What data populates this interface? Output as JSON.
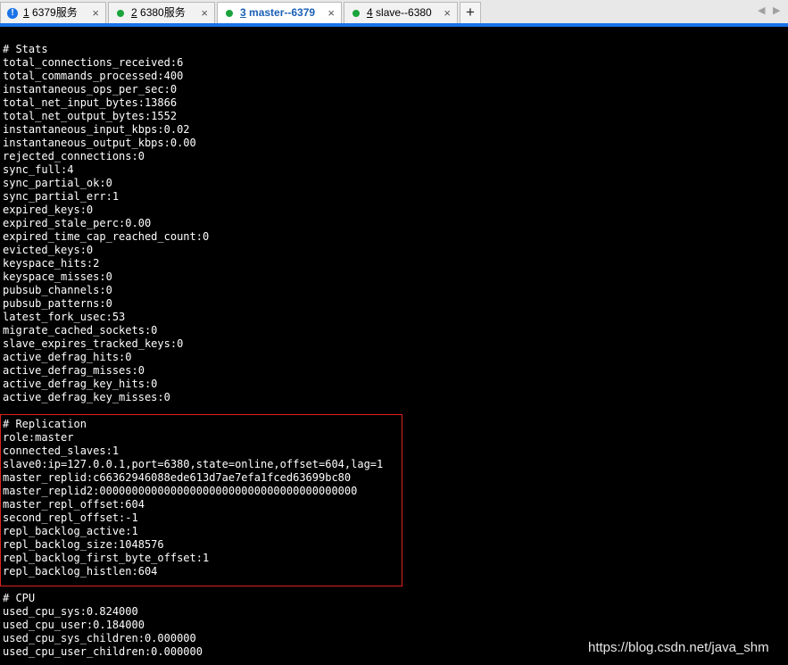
{
  "tabs": [
    {
      "index": "1",
      "title": "6379服务",
      "status_icon": "warning-icon",
      "close": "×"
    },
    {
      "index": "2",
      "title": "6380服务",
      "status_icon": "green-dot-icon",
      "close": "×"
    },
    {
      "index": "3",
      "title": "master--6379",
      "status_icon": "green-dot-icon",
      "close": "×",
      "active": true
    },
    {
      "index": "4",
      "title": "slave--6380",
      "status_icon": "green-dot-icon",
      "close": "×"
    }
  ],
  "new_tab_label": "+",
  "nav": {
    "prev": "◀",
    "next": "▶"
  },
  "colors": {
    "accent": "#1a73e8",
    "status_green": "#1aa33c",
    "highlight_border": "#e02020",
    "terminal_bg": "#000000",
    "terminal_text": "#ffffff"
  },
  "terminal": {
    "stats": [
      "# Stats",
      "total_connections_received:6",
      "total_commands_processed:400",
      "instantaneous_ops_per_sec:0",
      "total_net_input_bytes:13866",
      "total_net_output_bytes:1552",
      "instantaneous_input_kbps:0.02",
      "instantaneous_output_kbps:0.00",
      "rejected_connections:0",
      "sync_full:4",
      "sync_partial_ok:0",
      "sync_partial_err:1",
      "expired_keys:0",
      "expired_stale_perc:0.00",
      "expired_time_cap_reached_count:0",
      "evicted_keys:0",
      "keyspace_hits:2",
      "keyspace_misses:0",
      "pubsub_channels:0",
      "pubsub_patterns:0",
      "latest_fork_usec:53",
      "migrate_cached_sockets:0",
      "slave_expires_tracked_keys:0",
      "active_defrag_hits:0",
      "active_defrag_misses:0",
      "active_defrag_key_hits:0",
      "active_defrag_key_misses:0"
    ],
    "replication": [
      "# Replication",
      "role:master",
      "connected_slaves:1",
      "slave0:ip=127.0.0.1,port=6380,state=online,offset=604,lag=1",
      "master_replid:c66362946088ede613d7ae7efa1fced63699bc80",
      "master_replid2:0000000000000000000000000000000000000000",
      "master_repl_offset:604",
      "second_repl_offset:-1",
      "repl_backlog_active:1",
      "repl_backlog_size:1048576",
      "repl_backlog_first_byte_offset:1",
      "repl_backlog_histlen:604"
    ],
    "cpu": [
      "# CPU",
      "used_cpu_sys:0.824000",
      "used_cpu_user:0.184000",
      "used_cpu_sys_children:0.000000",
      "used_cpu_user_children:0.000000"
    ]
  },
  "watermark": "https://blog.csdn.net/java_shm"
}
